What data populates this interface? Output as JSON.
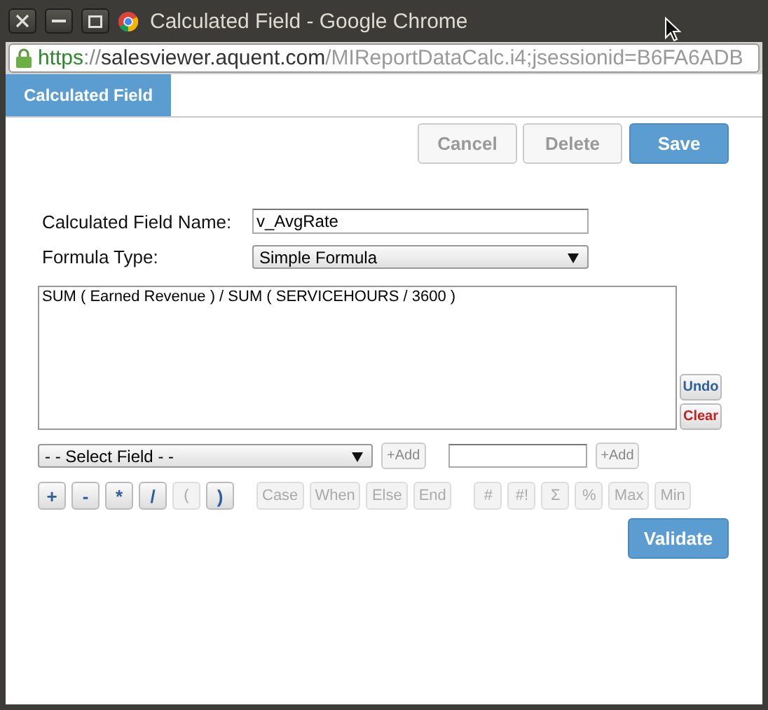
{
  "window": {
    "title": "Calculated Field - Google Chrome"
  },
  "address_bar": {
    "scheme": "https",
    "separator": "://",
    "host": "salesviewer.aquent.com",
    "path": "/MIReportDataCalc.i4;jsessionid=B6FA6ADB"
  },
  "tabs": [
    {
      "label": "Calculated Field",
      "selected": true
    }
  ],
  "actions": [
    {
      "label": "Cancel",
      "kind": "plain",
      "disabled": true
    },
    {
      "label": "Delete",
      "kind": "plain",
      "disabled": true
    },
    {
      "label": "Save",
      "kind": "primary",
      "disabled": false
    }
  ],
  "form": {
    "name_label": "Calculated Field Name:",
    "name_value": "v_AvgRate",
    "type_label": "Formula Type:",
    "type_value": "Simple Formula"
  },
  "formula": {
    "value": "SUM ( Earned Revenue ) / SUM ( SERVICEHOURS / 3600 )"
  },
  "formula_buttons": [
    {
      "label": "Undo",
      "kind": "undo"
    },
    {
      "label": "Clear",
      "kind": "clear"
    }
  ],
  "field_row": {
    "select_value": "- - Select Field - -",
    "add_label": "+Add",
    "constant_add_label": "+Add"
  },
  "operator_groups": [
    [
      {
        "label": "+",
        "disabled": false
      },
      {
        "label": "-",
        "disabled": false
      },
      {
        "label": "*",
        "disabled": false
      },
      {
        "label": "/",
        "disabled": false
      },
      {
        "label": "(",
        "disabled": true
      },
      {
        "label": ")",
        "disabled": false
      }
    ],
    [
      {
        "label": "Case",
        "disabled": true
      },
      {
        "label": "When",
        "disabled": true
      },
      {
        "label": "Else",
        "disabled": true
      },
      {
        "label": "End",
        "disabled": true
      }
    ],
    [
      {
        "label": "#",
        "disabled": true
      },
      {
        "label": "#!",
        "disabled": true
      },
      {
        "label": "Σ",
        "disabled": true
      },
      {
        "label": "%",
        "disabled": true
      },
      {
        "label": "Max",
        "disabled": true
      },
      {
        "label": "Min",
        "disabled": true
      }
    ]
  ],
  "validate": {
    "label": "Validate"
  }
}
